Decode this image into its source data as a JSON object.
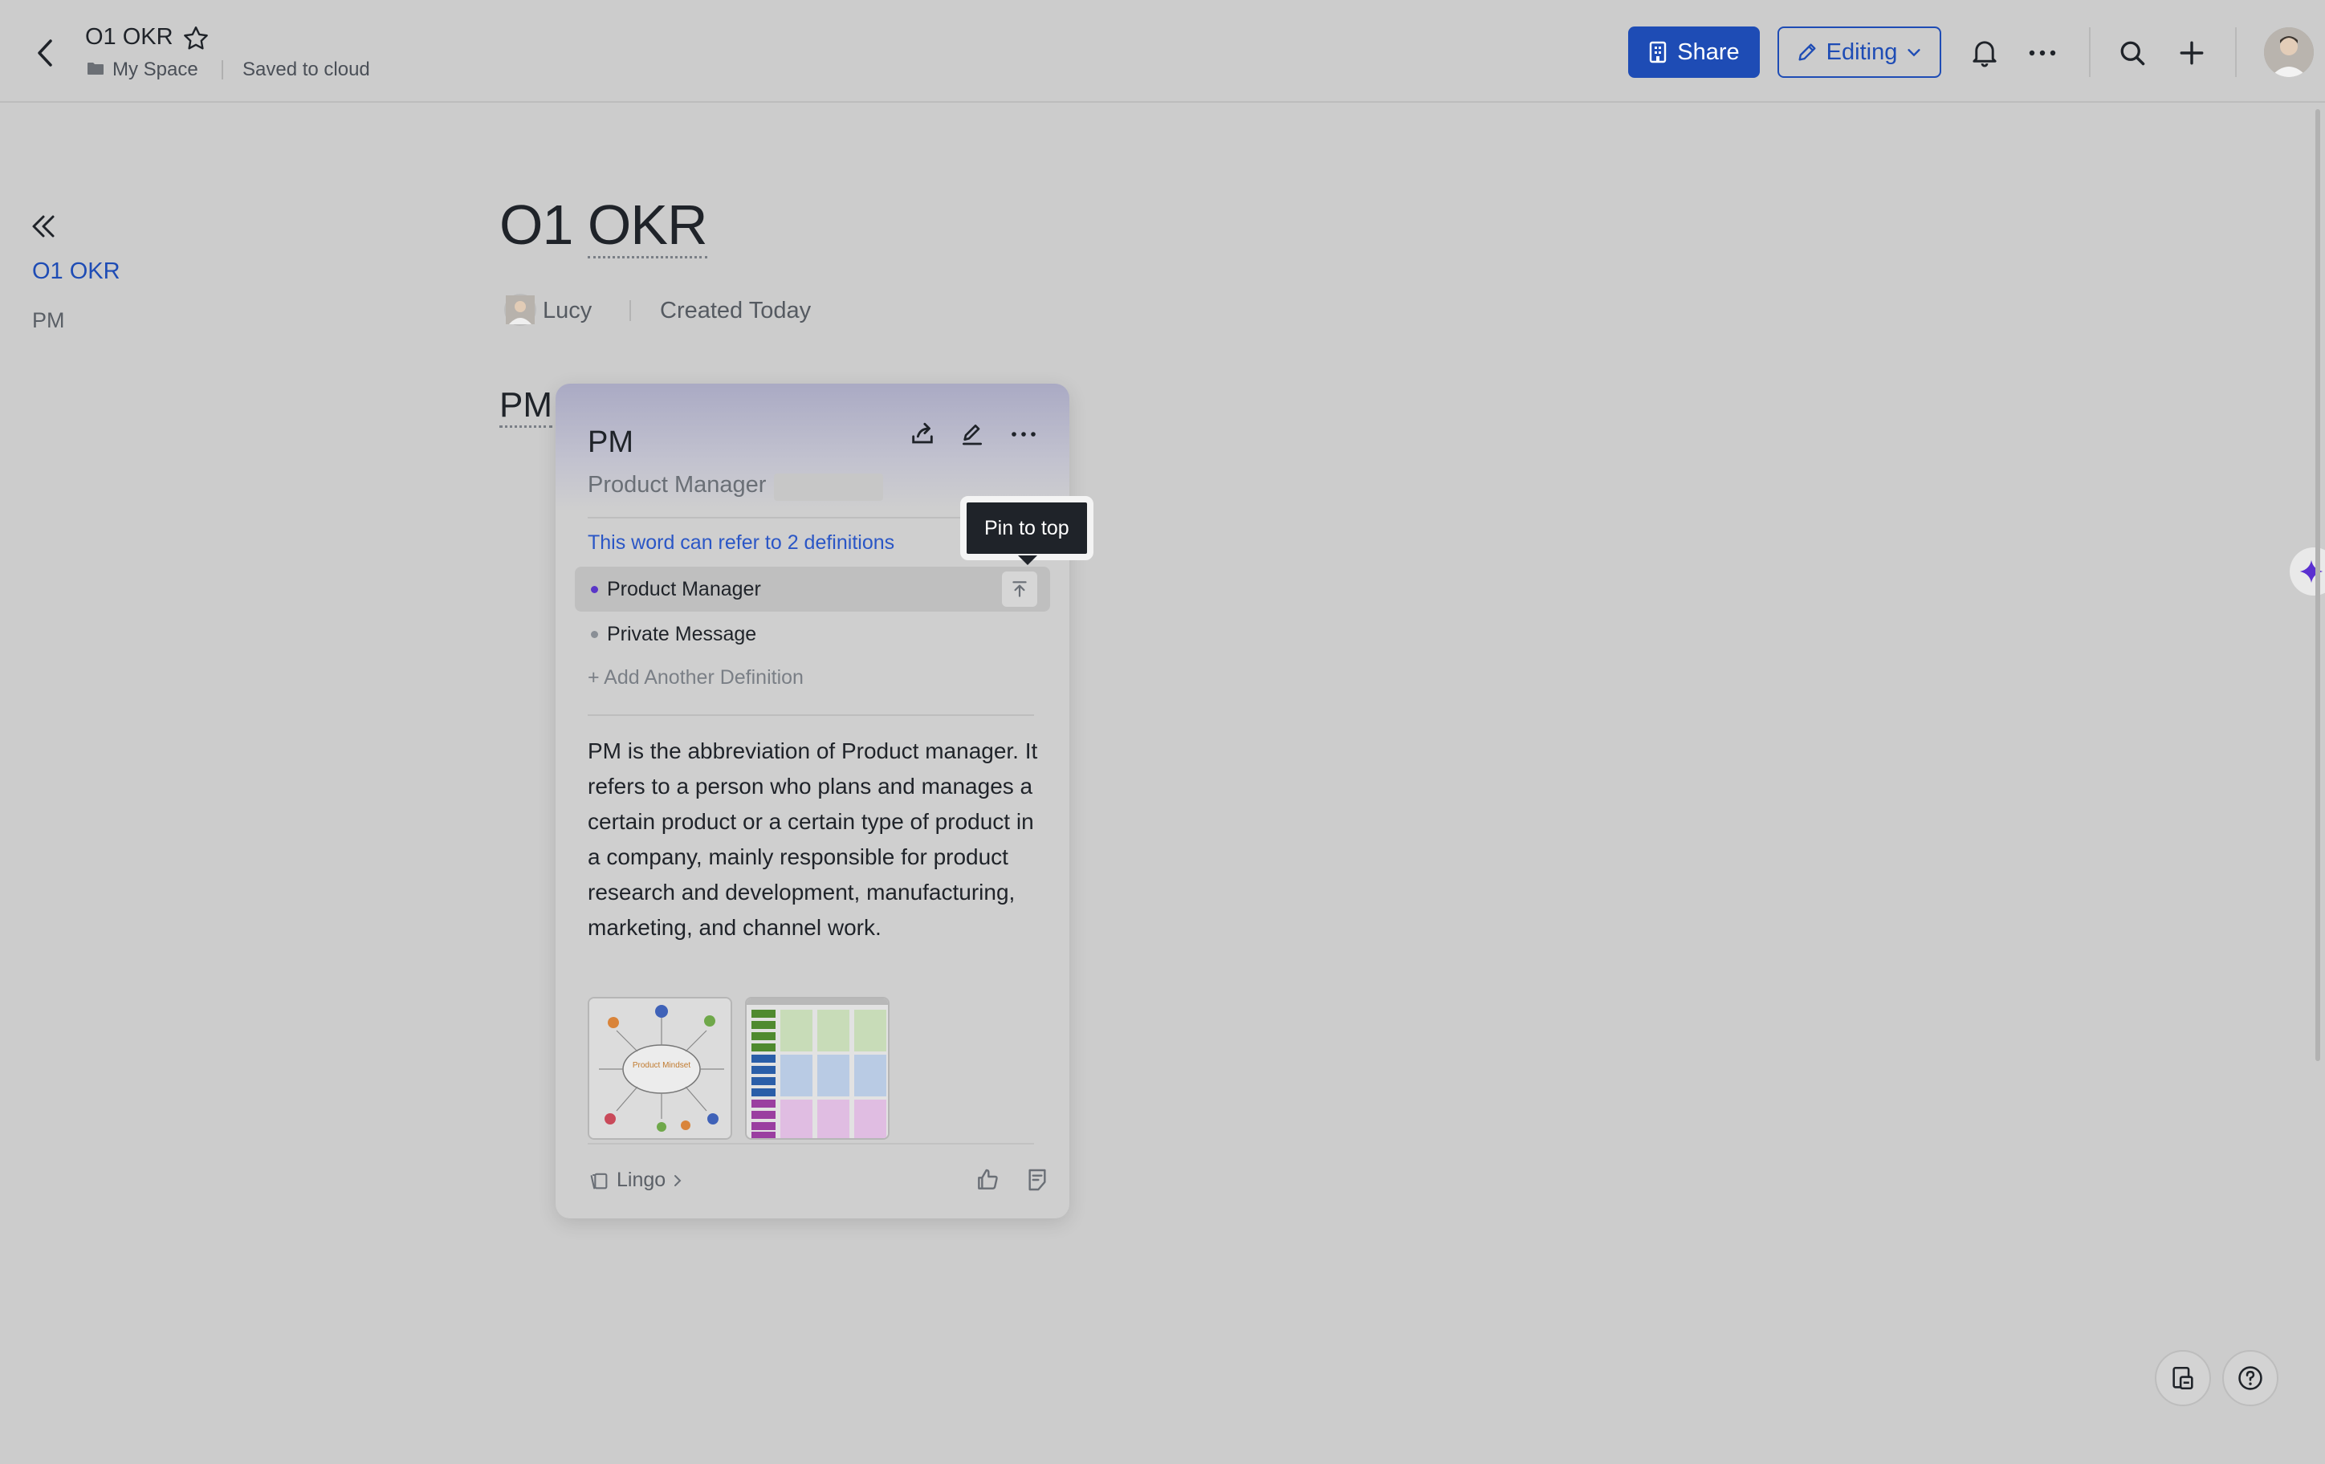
{
  "header": {
    "doc_title": "O1 OKR",
    "breadcrumb_space": "My Space",
    "save_status": "Saved to cloud",
    "share_label": "Share",
    "editing_label": "Editing"
  },
  "outline": {
    "items": [
      {
        "label": "O1 OKR",
        "active": true
      },
      {
        "label": "PM",
        "active": false
      }
    ]
  },
  "document": {
    "title_prefix": "O1",
    "title_term": "OKR",
    "author": "Lucy",
    "created": "Created Today",
    "heading": "PM"
  },
  "lingo_card": {
    "term": "PM",
    "subtitle": "Product Manager",
    "definitions_note": "This word can refer to 2 definitions",
    "definitions": [
      {
        "label": "Product Manager",
        "active": true
      },
      {
        "label": "Private Message",
        "active": false
      }
    ],
    "add_definition": "+ Add Another Definition",
    "description": "PM is the abbreviation of Product manager. It refers to a person who plans and manages a certain product or a certain type of product in a company, mainly responsible for product research and development, manufacturing, marketing, and channel work.",
    "image1_caption": "Product Mindset",
    "source_label": "Lingo"
  },
  "tooltip": {
    "text": "Pin to top"
  },
  "colors": {
    "accent": "#1e4cb5",
    "link": "#2a56c6",
    "tooltip_bg": "#1f2329",
    "background": "#cccccc"
  }
}
